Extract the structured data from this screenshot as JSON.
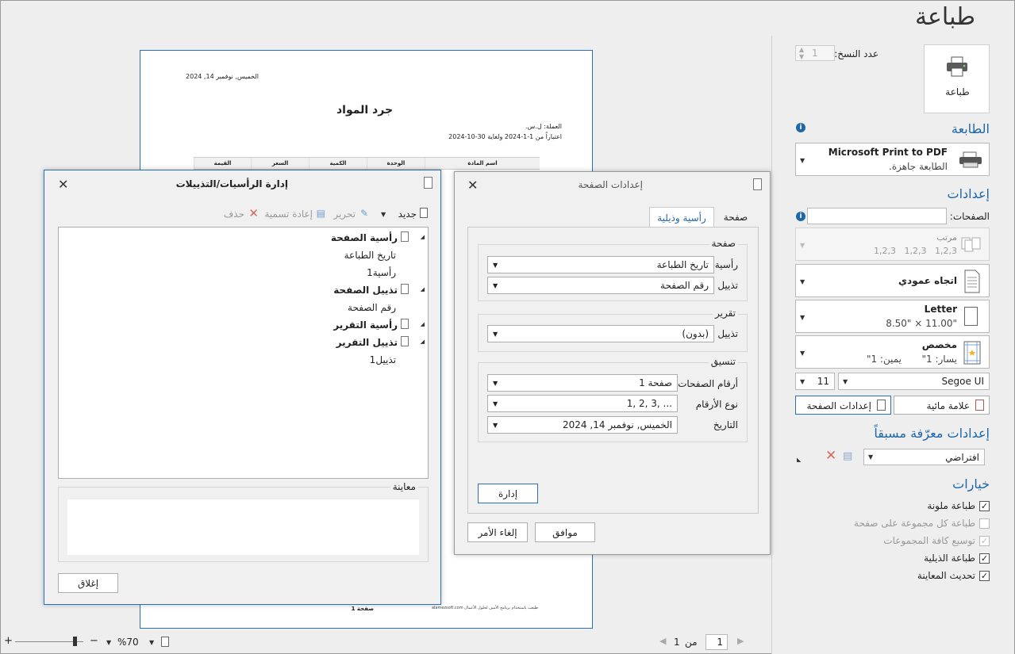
{
  "window": {
    "title": "طباعة"
  },
  "print_button": {
    "label": "طباعة",
    "icon": "printer-icon"
  },
  "copies": {
    "label": "عدد النسخ:",
    "value": "1"
  },
  "printer": {
    "section": "الطابعة",
    "name": "Microsoft Print to PDF",
    "status": "الطابعة جاهزة."
  },
  "settings": {
    "section": "إعدادات",
    "pages_label": "الصفحات:",
    "pages_value": "",
    "collate": {
      "title": "مرتب",
      "value": "1,2,3   1,2,3   1,2,3"
    },
    "orientation": "اتجاه عمودي",
    "paper": {
      "title": "Letter",
      "size": "8.50\" × 11.00\""
    },
    "margins": {
      "title": "مخصص",
      "left": "يسار: 1\"",
      "right": "يمين: 1\""
    },
    "font": {
      "name": "Segoe UI",
      "size": "11"
    },
    "page_setup_button": "إعدادات الصفحة",
    "watermark_button": "علامة مائية"
  },
  "presets": {
    "section": "إعدادات معرّفة مسبقاً",
    "value": "افتراضي"
  },
  "options": {
    "section": "خيارات",
    "items": [
      {
        "label": "طباعة ملونة",
        "checked": true,
        "disabled": false
      },
      {
        "label": "طباعة كل مجموعة على صفحة",
        "checked": false,
        "disabled": true
      },
      {
        "label": "توسيع كافة المجموعات",
        "checked": true,
        "disabled": true
      },
      {
        "label": "طباعة الذيلية",
        "checked": true,
        "disabled": false
      },
      {
        "label": "تحديث المعاينة",
        "checked": true,
        "disabled": false
      }
    ]
  },
  "preview_page": {
    "date": "الخميس, نوفمبر 14, 2024",
    "title": "جرد المواد",
    "currency": "العملة: ل.س.",
    "period": "اعتباراً من 1-1-2024 ولغاية 30-10-2024",
    "columns": [
      "اسم المادة",
      "الوحدة",
      "الكمية",
      "السعر",
      "القيمة"
    ],
    "footer_page": "صفحة 1",
    "footer_note": "طبعت باستخدام برنامج الأمين لحلول الأعمال   alamezsoft.com"
  },
  "bottom_bar": {
    "zoom": "%70",
    "page_current": "1",
    "page_of": "من",
    "page_total": "1"
  },
  "page_setup_dialog": {
    "title": "إعدادات الصفحة",
    "tabs": [
      "صفحة",
      "رأسية وذيلية"
    ],
    "page_group": "صفحة",
    "header_label": "رأسية",
    "header_value": "تاريخ الطباعة",
    "footer_label": "تذييل",
    "footer_value": "رقم الصفحة",
    "report_group": "تقرير",
    "report_footer_label": "تذييل",
    "report_footer_value": "(بدون)",
    "format_group": "تنسيق",
    "page_numbers_label": "أرقام الصفحات",
    "page_numbers_value": "صفحة 1",
    "number_type_label": "نوع الأرقام",
    "number_type_value": "1, 2, 3, ...",
    "date_label": "التاريخ",
    "date_value": "الخميس, نوفمبر 14, 2024",
    "manage_button": "إدارة",
    "ok_button": "موافق",
    "cancel_button": "إلغاء الأمر"
  },
  "manage_dialog": {
    "title": "إدارة الرأسيات/التذييلات",
    "toolbar": {
      "new": "جديد",
      "edit": "تحرير",
      "rename": "إعادة تسمية",
      "delete": "حذف"
    },
    "tree": [
      {
        "label": "رأسية الصفحة",
        "bold": true,
        "level": 0
      },
      {
        "label": "تاريخ الطباعة",
        "bold": false,
        "level": 1
      },
      {
        "label": "رأسية1",
        "bold": false,
        "level": 1
      },
      {
        "label": "تذييل الصفحة",
        "bold": true,
        "level": 0
      },
      {
        "label": "رقم الصفحة",
        "bold": false,
        "level": 1
      },
      {
        "label": "رأسية التقرير",
        "bold": true,
        "level": 0
      },
      {
        "label": "تذييل التقرير",
        "bold": true,
        "level": 0
      },
      {
        "label": "تذييل1",
        "bold": false,
        "level": 1
      }
    ],
    "preview_label": "معاينة",
    "close_button": "إغلاق"
  }
}
